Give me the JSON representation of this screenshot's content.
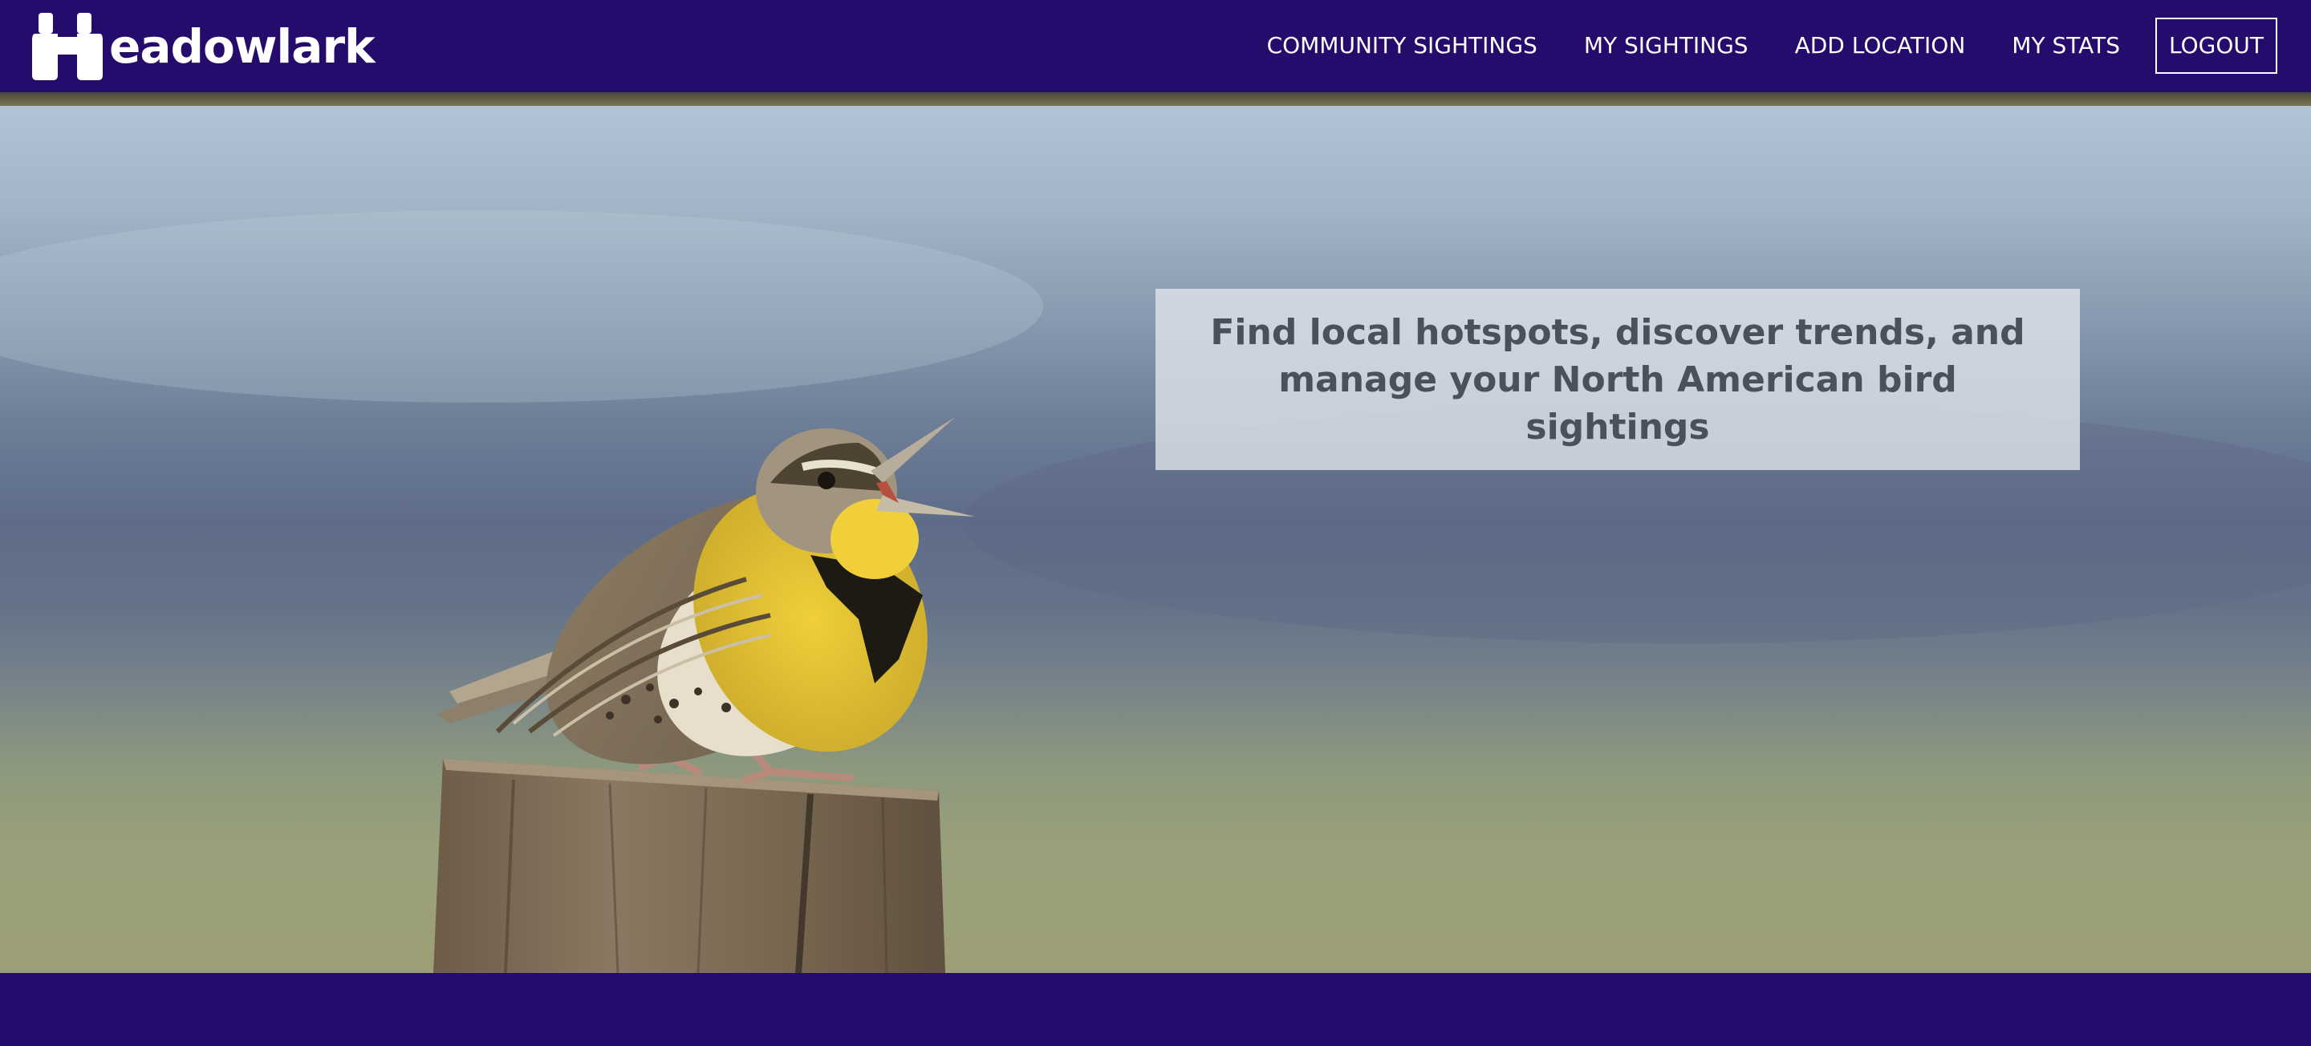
{
  "brand": {
    "name": "eadowlark",
    "icon": "binoculars-icon"
  },
  "nav": {
    "items": [
      {
        "label": "COMMUNITY SIGHTINGS"
      },
      {
        "label": "MY SIGHTINGS"
      },
      {
        "label": "ADD LOCATION"
      },
      {
        "label": "MY STATS"
      }
    ],
    "logout_label": "LOGOUT"
  },
  "hero": {
    "tagline": "Find local hotspots, discover trends, and manage your North American bird sightings",
    "image": "meadowlark-on-fence-post"
  },
  "colors": {
    "nav_bg": "#250b6b",
    "footer_bg": "#250b6b",
    "tagline_text": "#4b505a"
  }
}
